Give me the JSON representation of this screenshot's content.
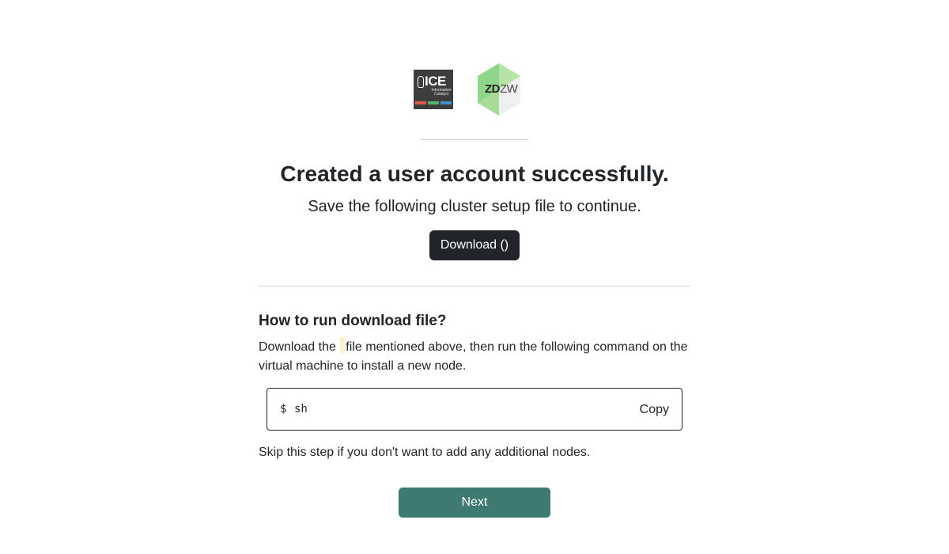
{
  "logos": {
    "ice": {
      "icon": "ice-logo",
      "word": "ICE",
      "subtitle": "Information Catalyst",
      "bar_colors": [
        "#e05a4f",
        "#56b36b",
        "#3f8fd1"
      ]
    },
    "zdzw": {
      "icon": "zdzw-logo",
      "bold_part": "ZD",
      "light_part": "ZW",
      "colors": [
        "#7fcf7c",
        "#b9e3a6",
        "#e6e6e6"
      ]
    }
  },
  "main": {
    "title": "Created a user account successfully.",
    "subtitle": "Save the following cluster setup file to continue.",
    "download_label": "Download ()"
  },
  "howto": {
    "heading": "How to run download file?",
    "text_before": "Download the",
    "text_after": "file mentioned above, then run the following command on the virtual machine to install a new node.",
    "prompt": "$",
    "command": "sh",
    "copy_label": "Copy",
    "skip_text": "Skip this step if you don't want to add any additional nodes."
  },
  "actions": {
    "next_label": "Next",
    "accent": "#3e7a72"
  }
}
